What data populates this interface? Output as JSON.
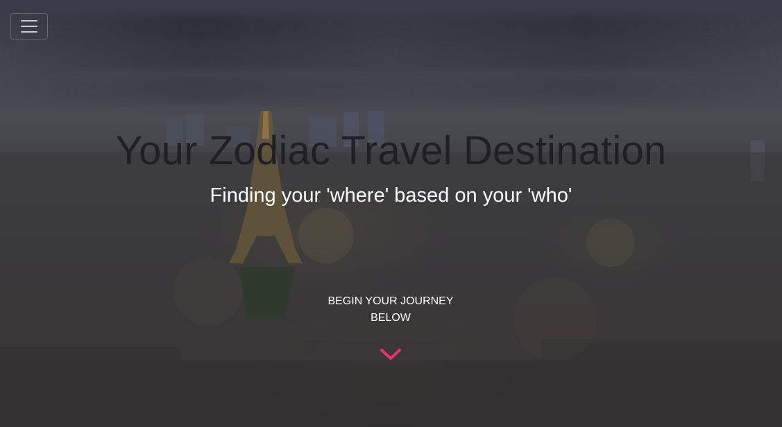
{
  "nav": {
    "toggle_icon": "hamburger-menu-icon"
  },
  "hero": {
    "title": "Your Zodiac Travel Destination",
    "subtitle": "Finding your 'where' based on your 'who'",
    "cta_line1": "BEGIN YOUR JOURNEY",
    "cta_line2": "BELOW",
    "scroll_icon": "chevron-down-icon",
    "accent_color": "#e8336f",
    "title_color": "#1f1f24",
    "subtitle_color": "#ffffff"
  }
}
